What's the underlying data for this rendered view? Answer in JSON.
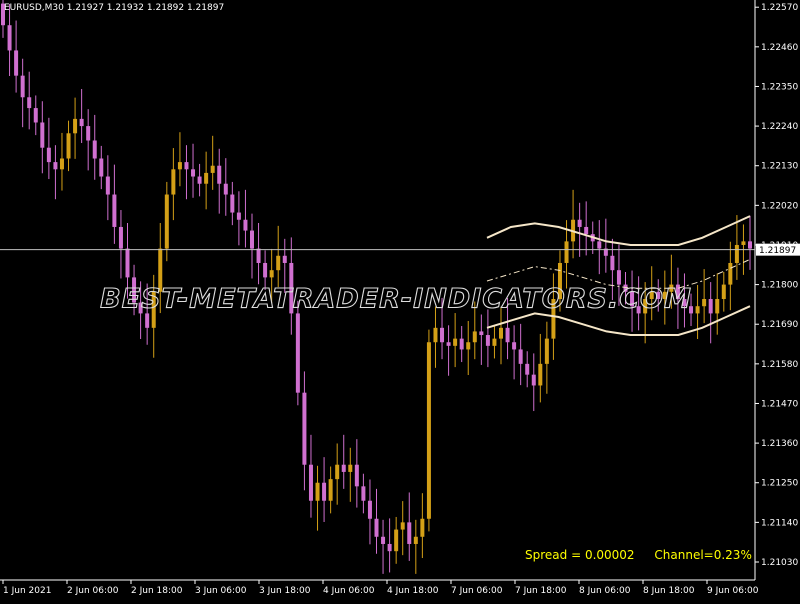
{
  "header": {
    "symbol": "EURUSD,M30",
    "ohlc": "1.21927 1.21932 1.21892 1.21897"
  },
  "info": {
    "spread": "Spread = 0.00002",
    "channel": "Channel=0.23%"
  },
  "watermark": "BEST-METATRADER-INDICATORS.COM",
  "colors": {
    "background": "#000000",
    "bull": "#d4a017",
    "bear": "#d070d0",
    "channel": "#f5e6c8",
    "axis": "#ffffff",
    "info": "#ffff00"
  },
  "chart_data": {
    "type": "candlestick",
    "symbol": "EURUSD",
    "timeframe": "M30",
    "ylim": [
      1.2098,
      1.2259
    ],
    "y_ticks": [
      "1.22570",
      "1.22460",
      "1.22350",
      "1.22240",
      "1.22130",
      "1.22020",
      "1.21910",
      "1.21800",
      "1.21690",
      "1.21580",
      "1.21470",
      "1.21360",
      "1.21250",
      "1.21140",
      "1.21030"
    ],
    "x_ticks": [
      "1 Jun 2021",
      "2 Jun 06:00",
      "2 Jun 18:00",
      "3 Jun 06:00",
      "3 Jun 18:00",
      "4 Jun 06:00",
      "4 Jun 18:00",
      "7 Jun 06:00",
      "7 Jun 18:00",
      "8 Jun 06:00",
      "8 Jun 18:00",
      "9 Jun 06:00"
    ],
    "current_price": "1.21897",
    "close_series": [
      1.2252,
      1.2245,
      1.2238,
      1.2232,
      1.2229,
      1.2225,
      1.2218,
      1.2214,
      1.2212,
      1.2215,
      1.2222,
      1.2226,
      1.2224,
      1.222,
      1.2215,
      1.221,
      1.2205,
      1.2196,
      1.219,
      1.2182,
      1.2175,
      1.2172,
      1.2168,
      1.2178,
      1.219,
      1.2205,
      1.2212,
      1.2214,
      1.2212,
      1.221,
      1.2208,
      1.2211,
      1.2213,
      1.2208,
      1.2205,
      1.22,
      1.2198,
      1.2195,
      1.219,
      1.2186,
      1.2182,
      1.2184,
      1.2188,
      1.2186,
      1.2172,
      1.215,
      1.213,
      1.212,
      1.2125,
      1.212,
      1.2126,
      1.213,
      1.2128,
      1.213,
      1.2124,
      1.212,
      1.2115,
      1.211,
      1.2108,
      1.2106,
      1.2112,
      1.2114,
      1.2108,
      1.211,
      1.2115,
      1.2164,
      1.2168,
      1.2164,
      1.2163,
      1.2165,
      1.2162,
      1.2164,
      1.2167,
      1.2166,
      1.2163,
      1.2165,
      1.2168,
      1.2164,
      1.2162,
      1.2158,
      1.2155,
      1.2152,
      1.2158,
      1.2165,
      1.2176,
      1.2186,
      1.2192,
      1.2198,
      1.2196,
      1.2194,
      1.2192,
      1.219,
      1.2188,
      1.2184,
      1.218,
      1.2178,
      1.2174,
      1.2172,
      1.2176,
      1.2178,
      1.2176,
      1.2178,
      1.218,
      1.2176,
      1.2174,
      1.2172,
      1.2174,
      1.2176,
      1.2172,
      1.2176,
      1.218,
      1.2186,
      1.2191,
      1.2192,
      1.219
    ],
    "channel": {
      "upper": [
        1.2193,
        1.2196,
        1.2197,
        1.2196,
        1.2194,
        1.2192,
        1.2191,
        1.2191,
        1.2191,
        1.2193,
        1.2196,
        1.2199
      ],
      "middle": [
        1.2181,
        1.2183,
        1.2185,
        1.2184,
        1.2182,
        1.218,
        1.2179,
        1.2179,
        1.2179,
        1.2181,
        1.2184,
        1.2187
      ],
      "lower": [
        1.2168,
        1.217,
        1.2172,
        1.2171,
        1.2169,
        1.2167,
        1.2166,
        1.2166,
        1.2166,
        1.2168,
        1.2171,
        1.2174
      ]
    }
  }
}
